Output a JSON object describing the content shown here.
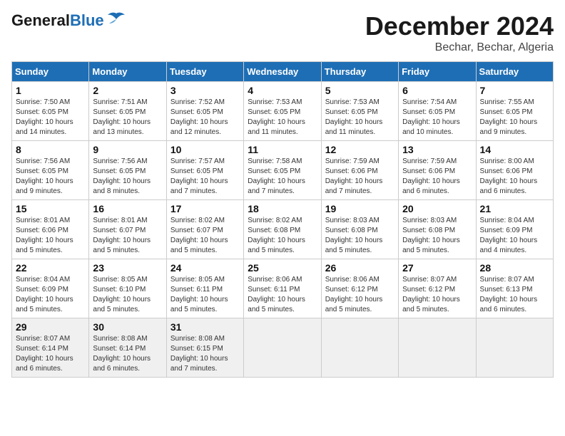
{
  "header": {
    "logo_general": "General",
    "logo_blue": "Blue",
    "month": "December 2024",
    "location": "Bechar, Bechar, Algeria"
  },
  "days_of_week": [
    "Sunday",
    "Monday",
    "Tuesday",
    "Wednesday",
    "Thursday",
    "Friday",
    "Saturday"
  ],
  "weeks": [
    [
      {
        "day": "1",
        "info": "Sunrise: 7:50 AM\nSunset: 6:05 PM\nDaylight: 10 hours\nand 14 minutes."
      },
      {
        "day": "2",
        "info": "Sunrise: 7:51 AM\nSunset: 6:05 PM\nDaylight: 10 hours\nand 13 minutes."
      },
      {
        "day": "3",
        "info": "Sunrise: 7:52 AM\nSunset: 6:05 PM\nDaylight: 10 hours\nand 12 minutes."
      },
      {
        "day": "4",
        "info": "Sunrise: 7:53 AM\nSunset: 6:05 PM\nDaylight: 10 hours\nand 11 minutes."
      },
      {
        "day": "5",
        "info": "Sunrise: 7:53 AM\nSunset: 6:05 PM\nDaylight: 10 hours\nand 11 minutes."
      },
      {
        "day": "6",
        "info": "Sunrise: 7:54 AM\nSunset: 6:05 PM\nDaylight: 10 hours\nand 10 minutes."
      },
      {
        "day": "7",
        "info": "Sunrise: 7:55 AM\nSunset: 6:05 PM\nDaylight: 10 hours\nand 9 minutes."
      }
    ],
    [
      {
        "day": "8",
        "info": "Sunrise: 7:56 AM\nSunset: 6:05 PM\nDaylight: 10 hours\nand 9 minutes."
      },
      {
        "day": "9",
        "info": "Sunrise: 7:56 AM\nSunset: 6:05 PM\nDaylight: 10 hours\nand 8 minutes."
      },
      {
        "day": "10",
        "info": "Sunrise: 7:57 AM\nSunset: 6:05 PM\nDaylight: 10 hours\nand 7 minutes."
      },
      {
        "day": "11",
        "info": "Sunrise: 7:58 AM\nSunset: 6:05 PM\nDaylight: 10 hours\nand 7 minutes."
      },
      {
        "day": "12",
        "info": "Sunrise: 7:59 AM\nSunset: 6:06 PM\nDaylight: 10 hours\nand 7 minutes."
      },
      {
        "day": "13",
        "info": "Sunrise: 7:59 AM\nSunset: 6:06 PM\nDaylight: 10 hours\nand 6 minutes."
      },
      {
        "day": "14",
        "info": "Sunrise: 8:00 AM\nSunset: 6:06 PM\nDaylight: 10 hours\nand 6 minutes."
      }
    ],
    [
      {
        "day": "15",
        "info": "Sunrise: 8:01 AM\nSunset: 6:06 PM\nDaylight: 10 hours\nand 5 minutes."
      },
      {
        "day": "16",
        "info": "Sunrise: 8:01 AM\nSunset: 6:07 PM\nDaylight: 10 hours\nand 5 minutes."
      },
      {
        "day": "17",
        "info": "Sunrise: 8:02 AM\nSunset: 6:07 PM\nDaylight: 10 hours\nand 5 minutes."
      },
      {
        "day": "18",
        "info": "Sunrise: 8:02 AM\nSunset: 6:08 PM\nDaylight: 10 hours\nand 5 minutes."
      },
      {
        "day": "19",
        "info": "Sunrise: 8:03 AM\nSunset: 6:08 PM\nDaylight: 10 hours\nand 5 minutes."
      },
      {
        "day": "20",
        "info": "Sunrise: 8:03 AM\nSunset: 6:08 PM\nDaylight: 10 hours\nand 5 minutes."
      },
      {
        "day": "21",
        "info": "Sunrise: 8:04 AM\nSunset: 6:09 PM\nDaylight: 10 hours\nand 4 minutes."
      }
    ],
    [
      {
        "day": "22",
        "info": "Sunrise: 8:04 AM\nSunset: 6:09 PM\nDaylight: 10 hours\nand 5 minutes."
      },
      {
        "day": "23",
        "info": "Sunrise: 8:05 AM\nSunset: 6:10 PM\nDaylight: 10 hours\nand 5 minutes."
      },
      {
        "day": "24",
        "info": "Sunrise: 8:05 AM\nSunset: 6:11 PM\nDaylight: 10 hours\nand 5 minutes."
      },
      {
        "day": "25",
        "info": "Sunrise: 8:06 AM\nSunset: 6:11 PM\nDaylight: 10 hours\nand 5 minutes."
      },
      {
        "day": "26",
        "info": "Sunrise: 8:06 AM\nSunset: 6:12 PM\nDaylight: 10 hours\nand 5 minutes."
      },
      {
        "day": "27",
        "info": "Sunrise: 8:07 AM\nSunset: 6:12 PM\nDaylight: 10 hours\nand 5 minutes."
      },
      {
        "day": "28",
        "info": "Sunrise: 8:07 AM\nSunset: 6:13 PM\nDaylight: 10 hours\nand 6 minutes."
      }
    ],
    [
      {
        "day": "29",
        "info": "Sunrise: 8:07 AM\nSunset: 6:14 PM\nDaylight: 10 hours\nand 6 minutes."
      },
      {
        "day": "30",
        "info": "Sunrise: 8:08 AM\nSunset: 6:14 PM\nDaylight: 10 hours\nand 6 minutes."
      },
      {
        "day": "31",
        "info": "Sunrise: 8:08 AM\nSunset: 6:15 PM\nDaylight: 10 hours\nand 7 minutes."
      },
      {
        "day": "",
        "info": ""
      },
      {
        "day": "",
        "info": ""
      },
      {
        "day": "",
        "info": ""
      },
      {
        "day": "",
        "info": ""
      }
    ]
  ]
}
